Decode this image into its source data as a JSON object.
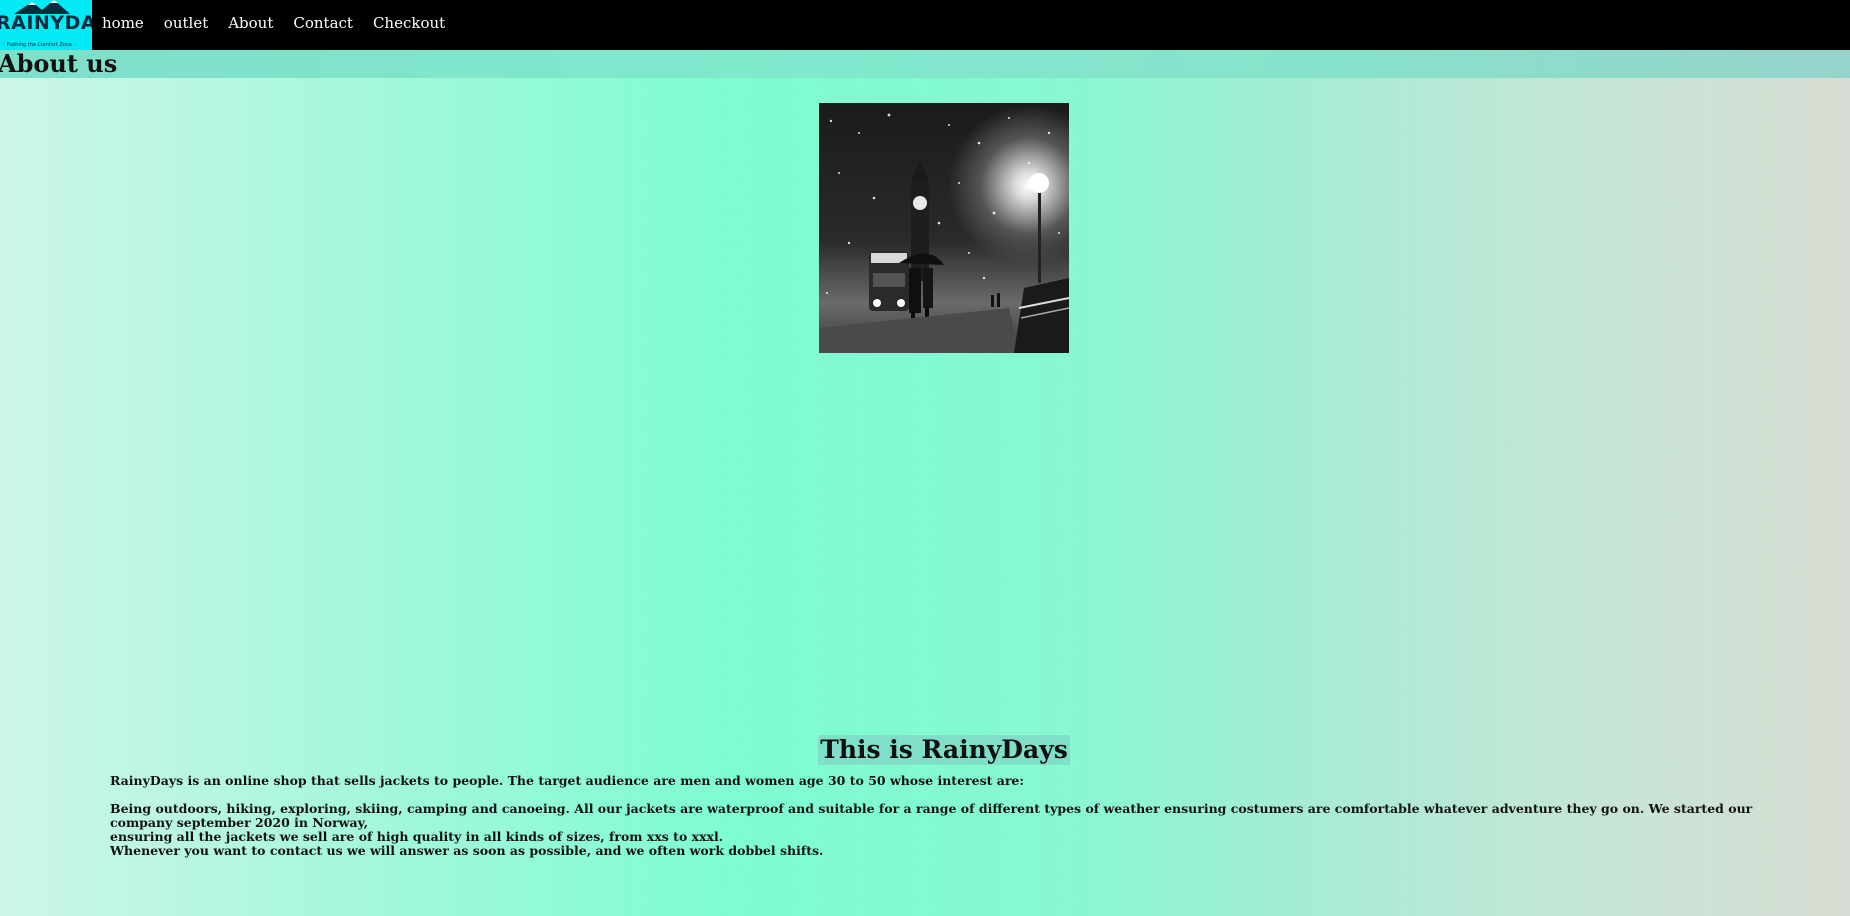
{
  "logo": {
    "brand": "RAINYDAYS",
    "tagline": "◦ Pushing the Comfort Zone ◦"
  },
  "nav": {
    "items": [
      {
        "label": "home"
      },
      {
        "label": "outlet"
      },
      {
        "label": "About"
      },
      {
        "label": "Contact"
      },
      {
        "label": "Checkout"
      }
    ]
  },
  "page": {
    "heading": "About us"
  },
  "main": {
    "title": "This is RainyDays",
    "intro": "RainyDays is an online shop that sells jackets to people. The target audience are men and women age 30 to 50 whose interest are:",
    "body_line1": "Being outdoors, hiking, exploring, skiing, camping and canoeing. All our jackets are waterproof and suitable for a range of different types of weather ensuring costumers are comfortable whatever adventure they go on. We started our company september 2020 in Norway,",
    "body_line2": "ensuring all the jackets we sell are of high quality in all kinds of sizes, from xxs to xxxl.",
    "body_line3": "Whenever you want to contact us we will answer as soon as possible, and we often work dobbel shifts."
  },
  "colors": {
    "navbar": "#000000",
    "logo_bg": "#03e9f5",
    "heading_band": "#7fdfc9"
  }
}
